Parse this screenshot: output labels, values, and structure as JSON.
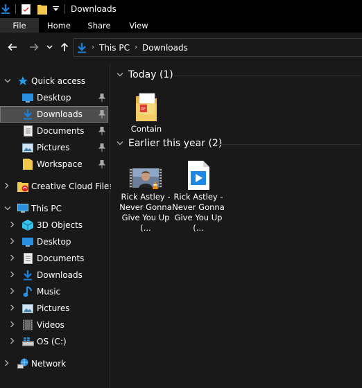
{
  "window": {
    "title": "Downloads",
    "accent": "#1a7fd4"
  },
  "ribbon": {
    "tabs": [
      "File",
      "Home",
      "Share",
      "View"
    ]
  },
  "address": {
    "crumbs": [
      "This PC",
      "Downloads"
    ]
  },
  "nav": {
    "quick_access": "Quick access",
    "quick_items": [
      "Desktop",
      "Downloads",
      "Documents",
      "Pictures",
      "Workspace"
    ],
    "creative_cloud": "Creative Cloud Files",
    "this_pc": "This PC",
    "pc_items": [
      "3D Objects",
      "Desktop",
      "Documents",
      "Downloads",
      "Music",
      "Pictures",
      "Videos",
      "OS (C:)"
    ],
    "network": "Network"
  },
  "groups": [
    {
      "header": "Today (1)",
      "files": [
        {
          "name": "Contain",
          "icon": "pdf-folder-icon"
        }
      ]
    },
    {
      "header": "Earlier this year (2)",
      "files": [
        {
          "name": "Rick Astley - Never Gonna Give You Up (...",
          "icon": "video-thumbnail-icon"
        },
        {
          "name": "Rick Astley - Never Gonna Give You Up (...",
          "icon": "media-player-file-icon"
        }
      ]
    }
  ]
}
